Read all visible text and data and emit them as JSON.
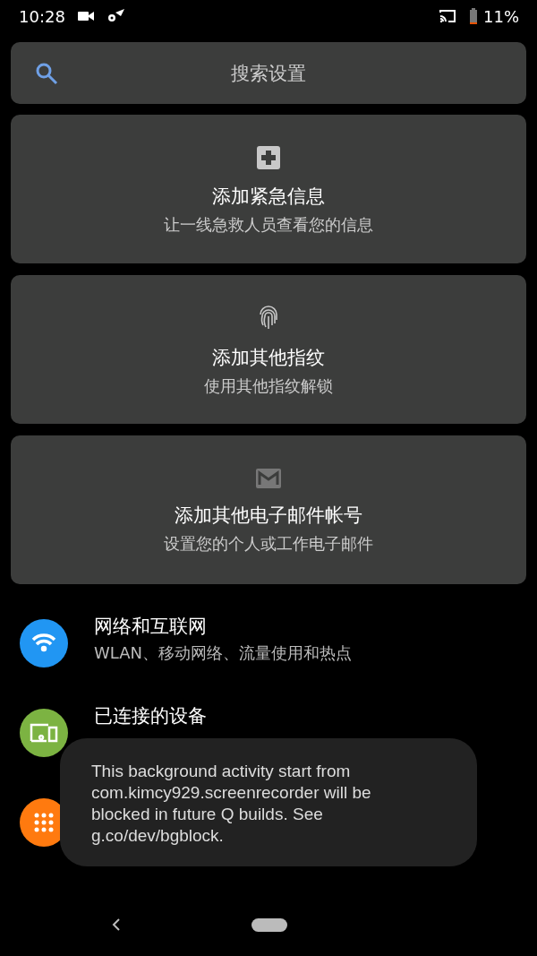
{
  "status_bar": {
    "time": "10:28",
    "battery": "11%"
  },
  "search": {
    "placeholder": "搜索设置"
  },
  "suggestions": [
    {
      "kind": "plus",
      "title": "添加紧急信息",
      "subtitle": "让一线急救人员查看您的信息"
    },
    {
      "kind": "fingerprint",
      "title": "添加其他指纹",
      "subtitle": "使用其他指纹解锁"
    },
    {
      "kind": "mail",
      "title": "添加其他电子邮件帐号",
      "subtitle": "设置您的个人或工作电子邮件"
    }
  ],
  "settings": [
    {
      "kind": "wifi",
      "color": "#2196f3",
      "title": "网络和互联网",
      "subtitle": "WLAN、移动网络、流量使用和热点"
    },
    {
      "kind": "devices",
      "color": "#7cb342",
      "title": "已连接的设备"
    },
    {
      "kind": "apps",
      "color": "#ff7a0f"
    }
  ],
  "toast": {
    "text": "This background activity start from com.kimcy929.screenrecorder will be blocked in future Q builds. See g.co/dev/bgblock."
  }
}
